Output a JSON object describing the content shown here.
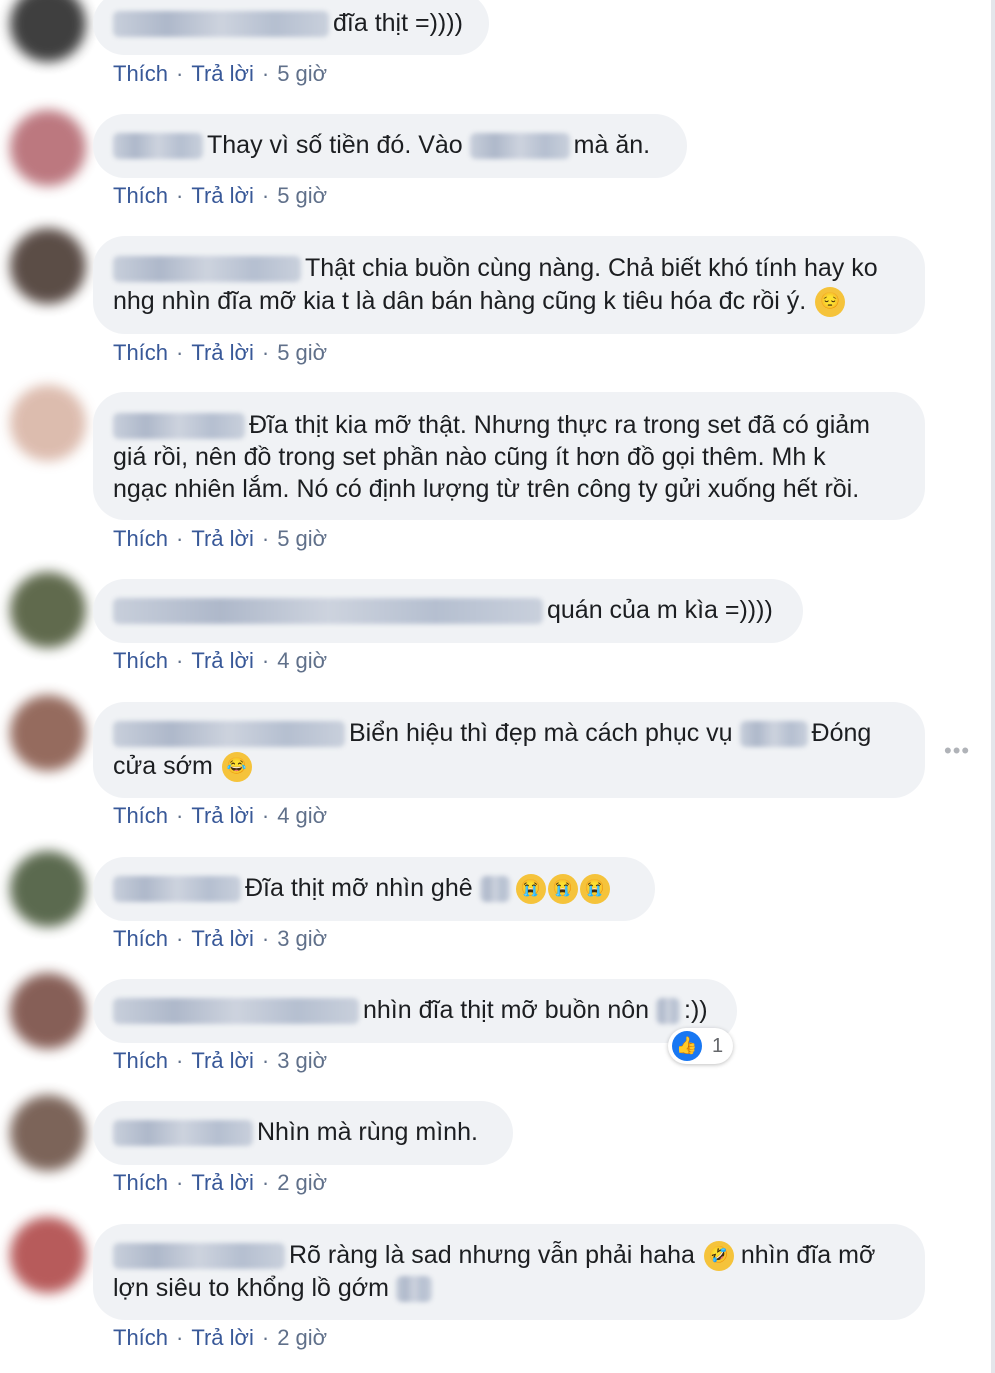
{
  "actions": {
    "like": "Thích",
    "reply": "Trả lời",
    "separator": "·"
  },
  "comments": [
    {
      "text": "đĩa thịt =))))",
      "time": "5 giờ"
    },
    {
      "text_a": "Thay vì số tiền đó. Vào",
      "text_b": "mà ăn.",
      "time": "5 giờ"
    },
    {
      "line1": "Thật chia buồn cùng nàng. Chả biết khó tính hay ko",
      "line2": "nhg nhìn đĩa mỡ kia t là dân bán hàng cũng k tiêu hóa đc rồi ý.",
      "emoji": "pensive-face",
      "time": "5 giờ"
    },
    {
      "line1": "Đĩa thịt kia mỡ thật. Nhưng thực ra trong set đã có giảm",
      "line2": "giá rồi, nên đồ trong set phần nào cũng ít hơn đồ gọi thêm. Mh k",
      "line3": "ngạc nhiên lắm. Nó có định lượng từ trên công ty gửi xuống hết rồi.",
      "time": "5 giờ"
    },
    {
      "text": "quán của m kìa =))))",
      "time": "4 giờ"
    },
    {
      "text_a": "Biển hiệu thì đẹp mà cách phục vụ",
      "text_b": "Đóng",
      "line2": "cửa sớm",
      "emoji": "laughing-tears-face",
      "time": "4 giờ"
    },
    {
      "text": "Đĩa thịt mỡ nhìn ghê",
      "emoji": "crying-face",
      "time": "3 giờ"
    },
    {
      "text_a": "nhìn đĩa thịt mỡ buồn nôn",
      "text_b": ":))",
      "reaction_count": "1",
      "time": "3 giờ"
    },
    {
      "text": "Nhìn mà rùng mình.",
      "time": "2 giờ"
    },
    {
      "line1": "Rõ ràng là sad nhưng vẫn phải haha",
      "line1b": "nhìn đĩa mỡ",
      "line2": "lợn siêu to khổng lồ gớm",
      "emoji": "rofl-face",
      "time": "2 giờ"
    }
  ],
  "colors": {
    "bubble": "#f0f2f5",
    "link": "#385898",
    "meta": "#60708a",
    "like_blue": "#1877f2"
  },
  "icons": {
    "more": "more-horizontal-icon",
    "like": "like-thumb-icon"
  }
}
